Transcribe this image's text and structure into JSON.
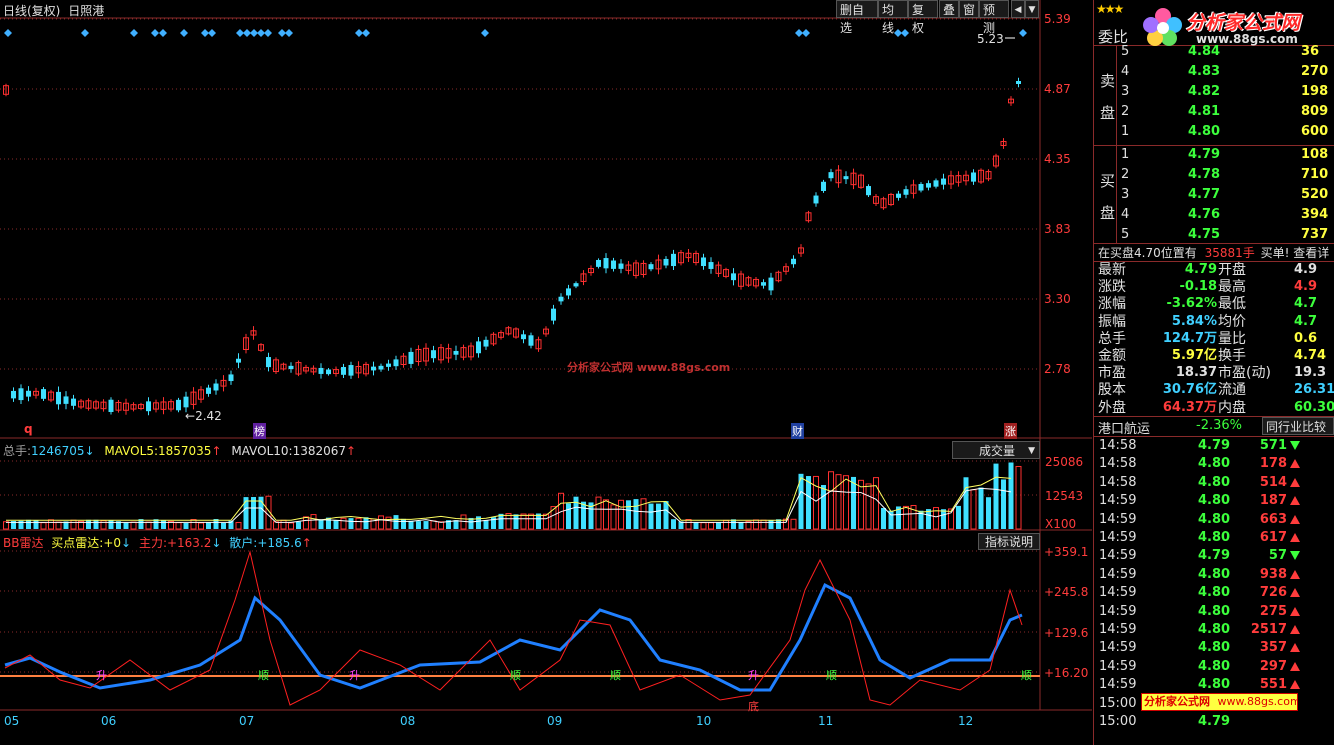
{
  "header": {
    "period": "日线(复权)",
    "stock_name": "日照港"
  },
  "toolbar": {
    "del_fav": "删自选",
    "ma": "均线",
    "fq": "复权",
    "overlay": "叠",
    "window": "窗",
    "predict": "预测"
  },
  "price_axis": [
    "5.39",
    "4.87",
    "4.35",
    "3.83",
    "3.30",
    "2.78"
  ],
  "price_annotations": {
    "high": "5.23",
    "low": "2.42"
  },
  "event_markers": {
    "q": "q",
    "bang": "榜",
    "cai": "财",
    "zhang": "涨"
  },
  "watermark": "分析家公式网 www.88gs.com",
  "volume_panel": {
    "total_label": "总手:",
    "total_value": "1246705",
    "ma5_label": "MAVOL5:",
    "ma5_value": "1857035",
    "ma10_label": "MAVOL10:",
    "ma10_value": "1382067",
    "dropdown": "成交量",
    "axis": [
      "25086",
      "12543",
      "X100"
    ]
  },
  "indicator_panel": {
    "name": "BB雷达",
    "buy_label": "买点雷达:",
    "buy_value": "+0",
    "main_label": "主力:",
    "main_value": "+163.2",
    "retail_label": "散户:",
    "retail_value": "+185.6",
    "help": "指标说明",
    "axis": [
      "+359.1",
      "+245.8",
      "+129.6",
      "+16.20"
    ],
    "signals": [
      "升",
      "顺",
      "升",
      "顺",
      "顺",
      "升",
      "顺",
      "顺",
      "底"
    ]
  },
  "x_axis": [
    "05",
    "06",
    "07",
    "08",
    "09",
    "10",
    "11",
    "12"
  ],
  "order_book": {
    "header": "委比",
    "sell_label_1": "卖",
    "sell_label_2": "盘",
    "buy_label_1": "买",
    "buy_label_2": "盘",
    "sell": [
      {
        "level": "5",
        "price": "4.84",
        "vol": "36"
      },
      {
        "level": "4",
        "price": "4.83",
        "vol": "270"
      },
      {
        "level": "3",
        "price": "4.82",
        "vol": "198"
      },
      {
        "level": "2",
        "price": "4.81",
        "vol": "809"
      },
      {
        "level": "1",
        "price": "4.80",
        "vol": "600"
      }
    ],
    "buy": [
      {
        "level": "1",
        "price": "4.79",
        "vol": "108"
      },
      {
        "level": "2",
        "price": "4.78",
        "vol": "710"
      },
      {
        "level": "3",
        "price": "4.77",
        "vol": "520"
      },
      {
        "level": "4",
        "price": "4.76",
        "vol": "394"
      },
      {
        "level": "5",
        "price": "4.75",
        "vol": "737"
      }
    ],
    "notice": "在买盘4.70位置有",
    "notice_vol": "35881手",
    "notice_tail": "买单! 查看详"
  },
  "quote": [
    {
      "l1": "最新",
      "v1": "4.79",
      "l2": "开盘",
      "v2": "4.9"
    },
    {
      "l1": "涨跌",
      "v1": "-0.18",
      "l2": "最高",
      "v2": "4.9"
    },
    {
      "l1": "涨幅",
      "v1": "-3.62%",
      "l2": "最低",
      "v2": "4.7"
    },
    {
      "l1": "振幅",
      "v1": "5.84%",
      "l2": "均价",
      "v2": "4.7"
    },
    {
      "l1": "总手",
      "v1": "124.7万",
      "l2": "量比",
      "v2": "0.6"
    },
    {
      "l1": "金额",
      "v1": "5.97亿",
      "l2": "换手",
      "v2": "4.74"
    },
    {
      "l1": "市盈",
      "v1": "18.37",
      "l2": "市盈(动)",
      "v2": "19.3"
    },
    {
      "l1": "股本",
      "v1": "30.76亿",
      "l2": "流通",
      "v2": "26.31"
    },
    {
      "l1": "外盘",
      "v1": "64.37万",
      "l2": "内盘",
      "v2": "60.30"
    }
  ],
  "sector": {
    "name": "港口航运",
    "change": "-2.36%",
    "compare": "同行业比较"
  },
  "ticks": [
    {
      "time": "14:58",
      "price": "4.79",
      "vol": "571",
      "dir": "down"
    },
    {
      "time": "14:58",
      "price": "4.80",
      "vol": "178",
      "dir": "up"
    },
    {
      "time": "14:58",
      "price": "4.80",
      "vol": "514",
      "dir": "up"
    },
    {
      "time": "14:59",
      "price": "4.80",
      "vol": "187",
      "dir": "up"
    },
    {
      "time": "14:59",
      "price": "4.80",
      "vol": "663",
      "dir": "up"
    },
    {
      "time": "14:59",
      "price": "4.80",
      "vol": "617",
      "dir": "up"
    },
    {
      "time": "14:59",
      "price": "4.79",
      "vol": "57",
      "dir": "down"
    },
    {
      "time": "14:59",
      "price": "4.80",
      "vol": "938",
      "dir": "up"
    },
    {
      "time": "14:59",
      "price": "4.80",
      "vol": "726",
      "dir": "up"
    },
    {
      "time": "14:59",
      "price": "4.80",
      "vol": "275",
      "dir": "up"
    },
    {
      "time": "14:59",
      "price": "4.80",
      "vol": "2517",
      "dir": "up"
    },
    {
      "time": "14:59",
      "price": "4.80",
      "vol": "357",
      "dir": "up"
    },
    {
      "time": "14:59",
      "price": "4.80",
      "vol": "297",
      "dir": "up"
    },
    {
      "time": "14:59",
      "price": "4.80",
      "vol": "551",
      "dir": "up"
    },
    {
      "time": "15:00",
      "price": "",
      "vol": "",
      "dir": ""
    },
    {
      "time": "15:00",
      "price": "4.79",
      "vol": "",
      "dir": ""
    }
  ],
  "logo": {
    "text": "分析家公式网",
    "url": "www.88gs.com"
  },
  "banner": {
    "text": "分析家公式网",
    "url": "www.88gs.com"
  }
}
